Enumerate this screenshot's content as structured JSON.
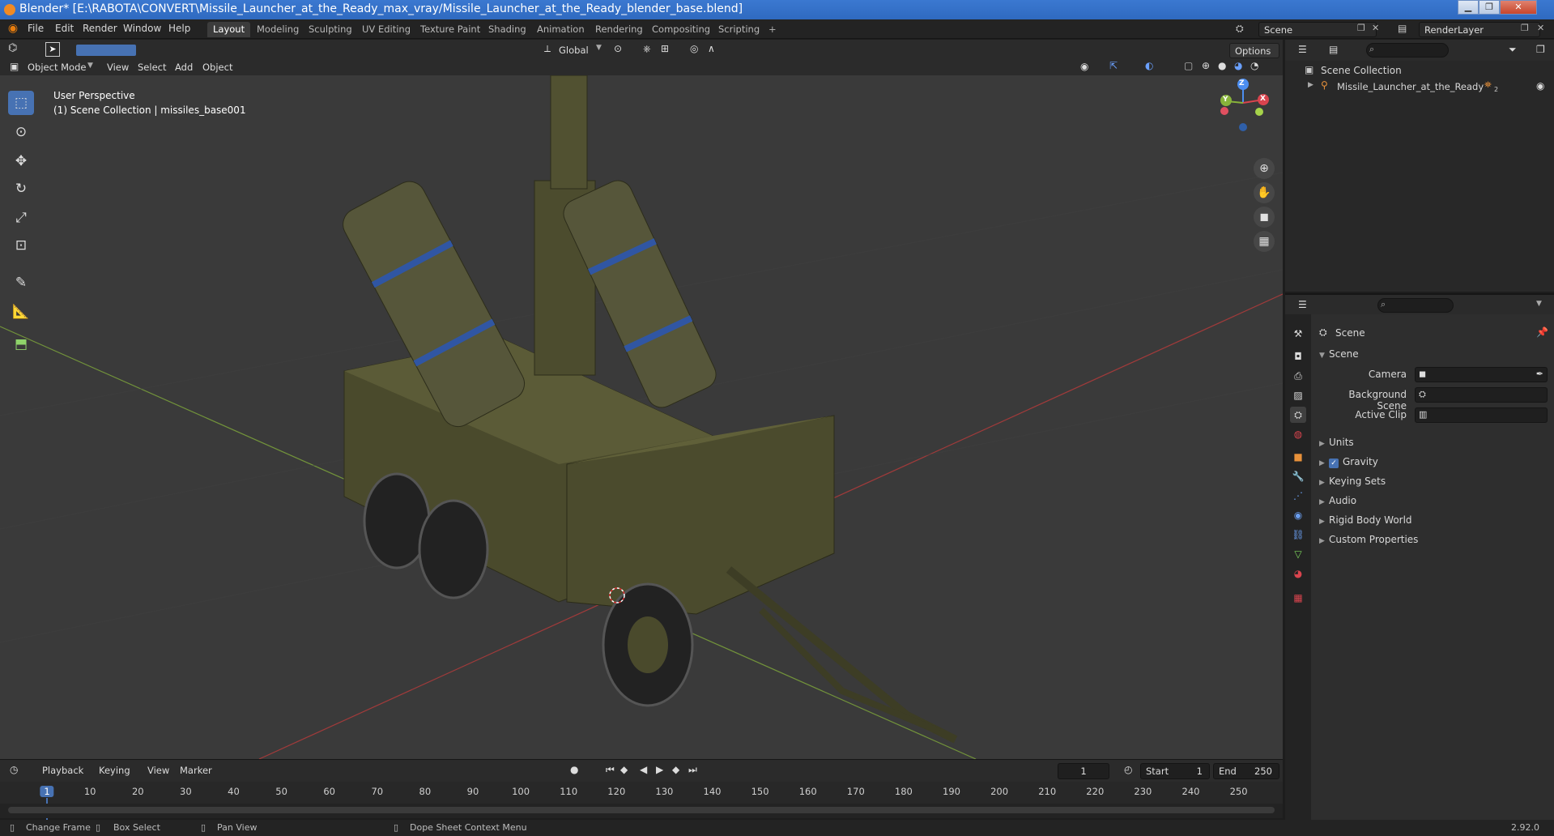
{
  "window": {
    "title": "Blender* [E:\\RABOTA\\CONVERT\\Missile_Launcher_at_the_Ready_max_vray/Missile_Launcher_at_the_Ready_blender_base.blend]",
    "minimize": "▁",
    "maximize": "❐",
    "close": "✕"
  },
  "menu": {
    "items": [
      "File",
      "Edit",
      "Render",
      "Window",
      "Help"
    ]
  },
  "workspaces": {
    "tabs": [
      "Layout",
      "Modeling",
      "Sculpting",
      "UV Editing",
      "Texture Paint",
      "Shading",
      "Animation",
      "Rendering",
      "Compositing",
      "Scripting"
    ],
    "active": "Layout",
    "add": "+"
  },
  "topright": {
    "scene": "Scene",
    "render_layer": "RenderLayer"
  },
  "viewport_header": {
    "transform_orientation": "Global",
    "options": "Options",
    "mode": "Object Mode",
    "menus": [
      "View",
      "Select",
      "Add",
      "Object"
    ]
  },
  "viewport": {
    "perspective": "User Perspective",
    "collection_info": "(1) Scene Collection | missiles_base001",
    "gizmo": {
      "z": "Z",
      "y": "Y",
      "x": "X"
    }
  },
  "timeline": {
    "menus": [
      "Playback",
      "Keying",
      "View",
      "Marker"
    ],
    "current_frame": "1",
    "start_label": "Start",
    "start": "1",
    "end_label": "End",
    "end": "250",
    "ruler": [
      "1",
      "10",
      "20",
      "30",
      "40",
      "50",
      "60",
      "70",
      "80",
      "90",
      "100",
      "110",
      "120",
      "130",
      "140",
      "150",
      "160",
      "170",
      "180",
      "190",
      "200",
      "210",
      "220",
      "230",
      "240",
      "250"
    ]
  },
  "status": {
    "change_frame": "Change Frame",
    "box_select": "Box Select",
    "pan_view": "Pan View",
    "context_menu": "Dope Sheet Context Menu",
    "version": "2.92.0"
  },
  "outliner": {
    "root": "Scene Collection",
    "items": [
      "Missile_Launcher_at_the_Ready"
    ],
    "badge": "2"
  },
  "properties": {
    "context": "Scene",
    "panel": "Scene",
    "fields": [
      {
        "label": "Camera"
      },
      {
        "label": "Background Scene"
      },
      {
        "label": "Active Clip"
      }
    ],
    "sections": [
      "Units",
      "Gravity",
      "Keying Sets",
      "Audio",
      "Rigid Body World",
      "Custom Properties"
    ]
  },
  "colors": {
    "accent": "#4772b3",
    "header": "#2b2b2b",
    "viewport_bg": "#3a3a3a",
    "axis_x": "#b33a3a",
    "axis_y": "#7ca33a"
  }
}
